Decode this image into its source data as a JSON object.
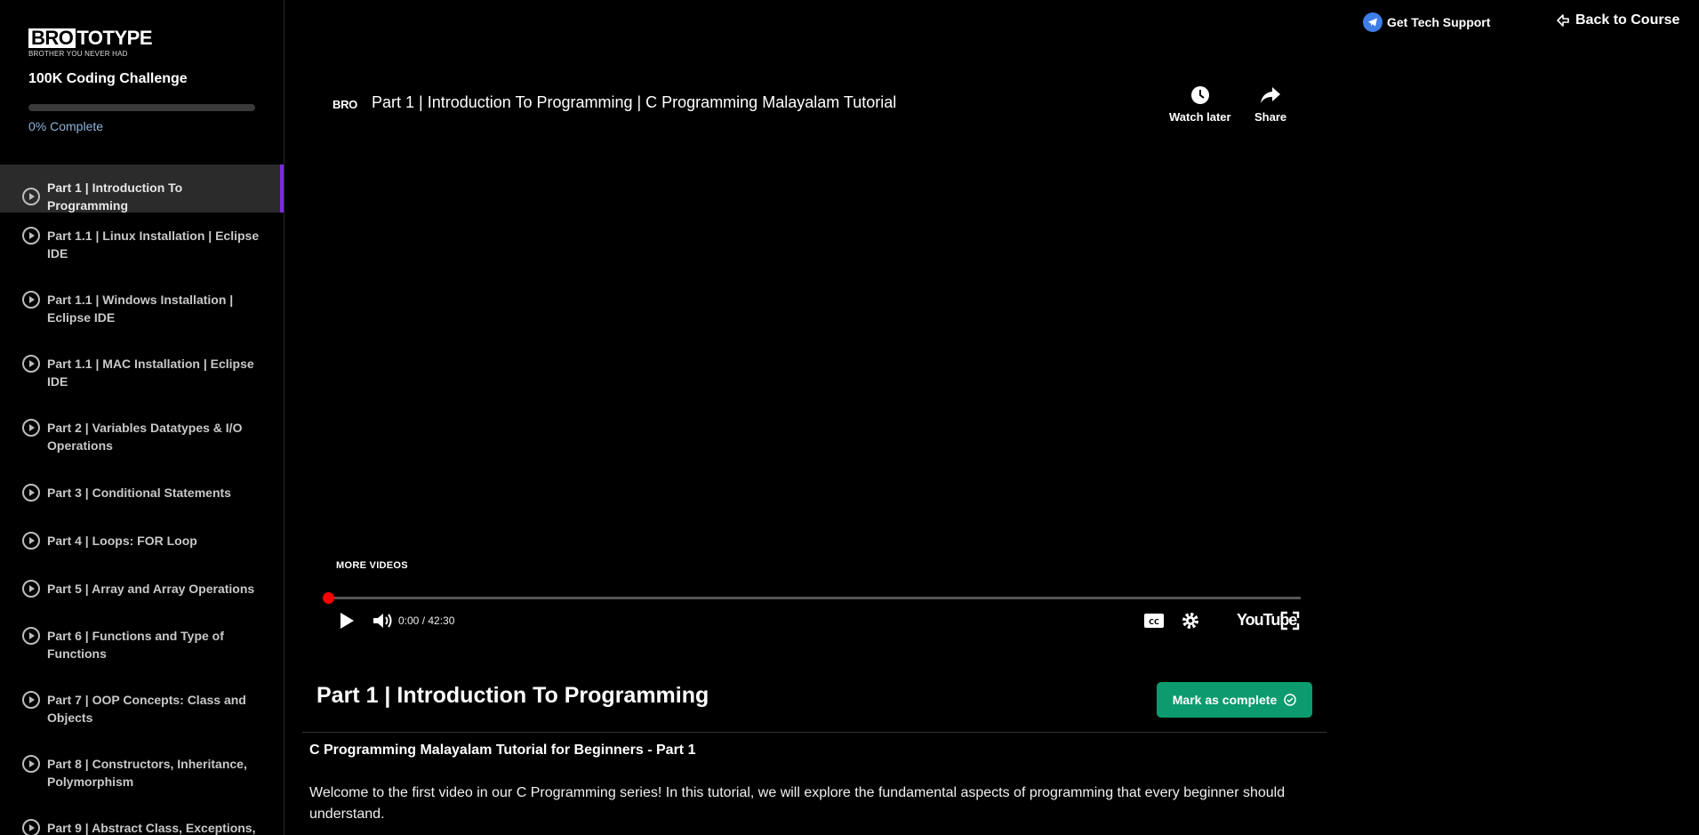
{
  "brand": {
    "logo_box": "BRO",
    "logo_rest": "TOTYPE",
    "tagline": "BROTHER YOU NEVER HAD"
  },
  "course": {
    "title": "100K Coding Challenge",
    "progress_label": "0% Complete",
    "progress_percent": 0
  },
  "lessons": [
    {
      "label": "Part 1 | Introduction To Programming",
      "active": true
    },
    {
      "label": "Part 1.1 | Linux Installation | Eclipse IDE"
    },
    {
      "label": "Part 1.1 | Windows Installation | Eclipse IDE"
    },
    {
      "label": "Part 1.1 | MAC Installation | Eclipse IDE"
    },
    {
      "label": "Part 2 | Variables Datatypes & I/O Operations"
    },
    {
      "label": "Part 3 | Conditional Statements"
    },
    {
      "label": "Part 4 | Loops: FOR Loop"
    },
    {
      "label": "Part 5 | Array and Array Operations"
    },
    {
      "label": "Part 6 | Functions and Type of Functions"
    },
    {
      "label": "Part 7 | OOP Concepts: Class and Objects"
    },
    {
      "label": "Part 8 | Constructors, Inheritance, Polymorphism"
    },
    {
      "label": "Part 9 | Abstract Class, Exceptions,"
    }
  ],
  "topbar": {
    "support_label": "Get Tech Support",
    "back_label": "Back to Course"
  },
  "video": {
    "channel_logo": "BRO",
    "title": "Part 1 | Introduction To Programming | C Programming Malayalam Tutorial",
    "watch_later_label": "Watch later",
    "share_label": "Share",
    "more_videos_label": "MORE VIDEOS",
    "time_display": "0:00 / 42:30",
    "youtube_wordmark": "YouTube",
    "progress_fraction": 0
  },
  "lesson_detail": {
    "heading": "Part 1 | Introduction To Programming",
    "mark_complete_label": "Mark as complete",
    "description_title": "C Programming Malayalam Tutorial for Beginners - Part 1",
    "description_body": "Welcome to the first video in our C Programming series! In this tutorial, we will explore the fundamental aspects of programming that every beginner should understand."
  },
  "colors": {
    "accent": "#7c2be0",
    "complete_button": "#0c9b6e",
    "support_icon": "#3f7ee8",
    "scrubber": "#ff0000"
  }
}
